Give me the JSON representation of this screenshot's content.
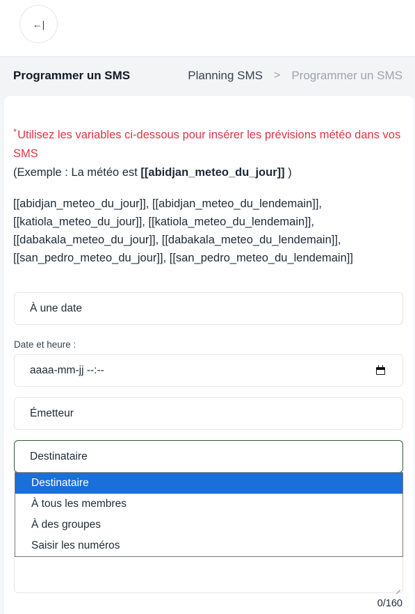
{
  "header": {
    "back_icon_glyph": "←|",
    "back_icon": "arrow-left-to-line-icon"
  },
  "titlebar": {
    "title": "Programmer un SMS",
    "breadcrumb": {
      "parent": "Planning SMS",
      "separator": ">",
      "current": "Programmer un SMS"
    }
  },
  "notice": {
    "star": "*",
    "line": "Utilisez les variables ci-dessous pour insérer les prévisions météo dans vos SMS",
    "example_prefix": "(Exemple : La météo est ",
    "example_var": "[[abidjan_meteo_du_jour]]",
    "example_suffix": " )"
  },
  "variables": {
    "line1": "[[abidjan_meteo_du_jour]], [[abidjan_meteo_du_lendemain]],",
    "line2": "[[katiola_meteo_du_jour]], [[katiola_meteo_du_lendemain]],",
    "line3": "[[dabakala_meteo_du_jour]], [[dabakala_meteo_du_lendemain]],",
    "line4": "[[san_pedro_meteo_du_jour]], [[san_pedro_meteo_du_lendemain]]"
  },
  "form": {
    "schedule_select": {
      "value": "À une date"
    },
    "datetime_label": "Date et heure :",
    "datetime_input": {
      "placeholder": "aaaa-mm-jj --:--",
      "icon": "calendar-icon"
    },
    "sender_select": {
      "value": "Émetteur"
    },
    "recipient_select": {
      "value": "Destinataire",
      "options": [
        "Destinataire",
        "À tous les membres",
        "À des groupes",
        "Saisir les numéros"
      ]
    },
    "message_counter": "0/160"
  },
  "colors": {
    "notice_red": "#dc3545",
    "selected_option": "#1a6fd8",
    "focus_border": "#2f5d3a"
  }
}
